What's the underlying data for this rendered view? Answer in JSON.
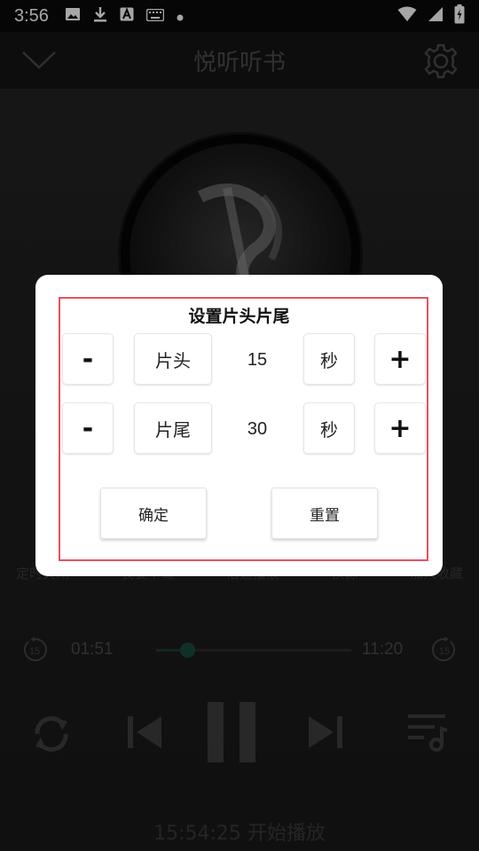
{
  "status_bar": {
    "time": "3:56",
    "icons": [
      "image-icon",
      "download-icon",
      "a-icon",
      "keyboard-icon",
      "dot-icon",
      "wifi-icon",
      "signal-icon",
      "battery-icon"
    ]
  },
  "app_bar": {
    "title": "悦听听书"
  },
  "player": {
    "functions": [
      "定时关闭",
      "我要下载",
      "倍速播放",
      "换源",
      "加入收藏"
    ],
    "elapsed": "01:51",
    "duration": "11:20",
    "progress_fraction": 0.16,
    "skip_back_seconds": "15",
    "skip_forward_seconds": "15",
    "status": "15:54:25  开始播放"
  },
  "dialog": {
    "title": "设置片头片尾",
    "intro": {
      "minus": "-",
      "label": "片头",
      "value": "15",
      "unit": "秒",
      "plus": "+"
    },
    "outro": {
      "minus": "-",
      "label": "片尾",
      "value": "30",
      "unit": "秒",
      "plus": "+"
    },
    "confirm_label": "确定",
    "reset_label": "重置"
  },
  "colors": {
    "highlight_frame": "#e9505d",
    "accent": "#1a4a3d"
  }
}
